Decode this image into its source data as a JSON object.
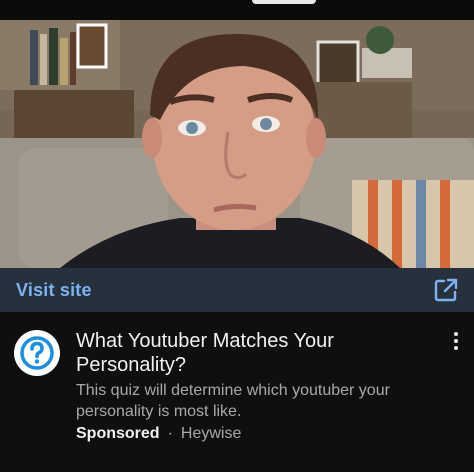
{
  "visit_bar": {
    "label": "Visit site",
    "icon": "external-link-icon",
    "accent": "#7db2f0",
    "background": "#27313d"
  },
  "ad": {
    "avatar_icon": "question-mark-icon",
    "avatar_color": "#1a8fe3",
    "title": "What Youtuber Matches Your Personality?",
    "description": "This quiz will determine which youtuber your personality is most like.",
    "sponsored_label": "Sponsored",
    "separator": "·",
    "advertiser": "Heywise",
    "more_icon": "more-vertical-icon"
  }
}
